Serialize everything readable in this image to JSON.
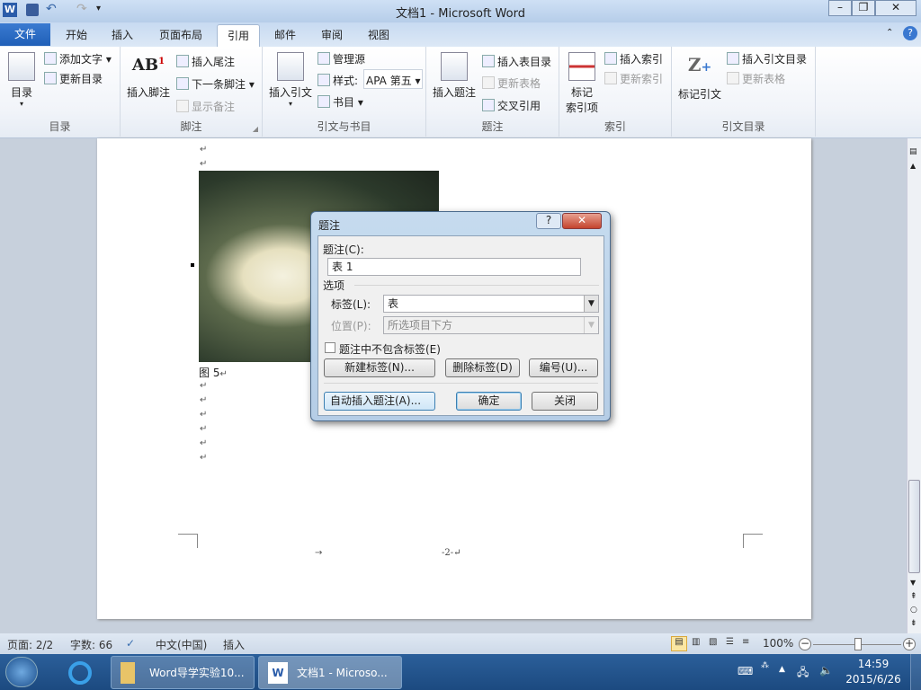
{
  "window": {
    "title": "文档1 - Microsoft Word",
    "app_icon": "word-icon"
  },
  "quick_access": [
    "save-icon",
    "undo-icon",
    "redo-icon",
    "customize-icon"
  ],
  "tabs": {
    "file": "文件",
    "items": [
      "开始",
      "插入",
      "页面布局",
      "引用",
      "邮件",
      "审阅",
      "视图"
    ],
    "active": "引用"
  },
  "ribbon": {
    "toc": {
      "label": "目录",
      "big": "目录",
      "add_text": "添加文字",
      "update": "更新目录"
    },
    "footnotes": {
      "label": "脚注",
      "big": "插入脚注",
      "insert_endnote": "插入尾注",
      "next_footnote": "下一条脚注",
      "show_notes": "显示备注"
    },
    "citations": {
      "label": "引文与书目",
      "big": "插入引文",
      "manage": "管理源",
      "style_label": "样式:",
      "style_value": "APA 第五",
      "bibliography": "书目"
    },
    "captions": {
      "label": "题注",
      "big": "插入题注",
      "insert_tof": "插入表目录",
      "update_table": "更新表格",
      "cross_ref": "交叉引用"
    },
    "index": {
      "label": "索引",
      "big1": "标记",
      "big2": "索引项",
      "insert_index": "插入索引",
      "update_index": "更新索引"
    },
    "toa": {
      "label": "引文目录",
      "big": "标记引文",
      "insert_toa": "插入引文目录",
      "update_table": "更新表格"
    }
  },
  "document": {
    "caption_text": "图 5",
    "paragraph_mark": "↵",
    "footer": "-2-↵",
    "tab_arrow": "→"
  },
  "dialog": {
    "title": "题注",
    "caption_label": "题注(C):",
    "caption_value": "表 1",
    "options": "选项",
    "label_label": "标签(L):",
    "label_value": "表",
    "position_label": "位置(P):",
    "position_value": "所选项目下方",
    "exclude_label": "题注中不包含标签(E)",
    "exclude_checked": false,
    "new_label": "新建标签(N)...",
    "delete_label": "删除标签(D)",
    "numbering": "编号(U)...",
    "autocaption": "自动插入题注(A)...",
    "ok": "确定",
    "close": "关闭"
  },
  "status": {
    "page": "页面: 2/2",
    "words": "字数: 66",
    "language": "中文(中国)",
    "mode": "插入",
    "zoom": "100%",
    "zoom_percent": 100
  },
  "taskbar": {
    "items": [
      "Word导学实验10...",
      "文档1 - Microso..."
    ],
    "time": "14:59",
    "date": "2015/6/26"
  }
}
